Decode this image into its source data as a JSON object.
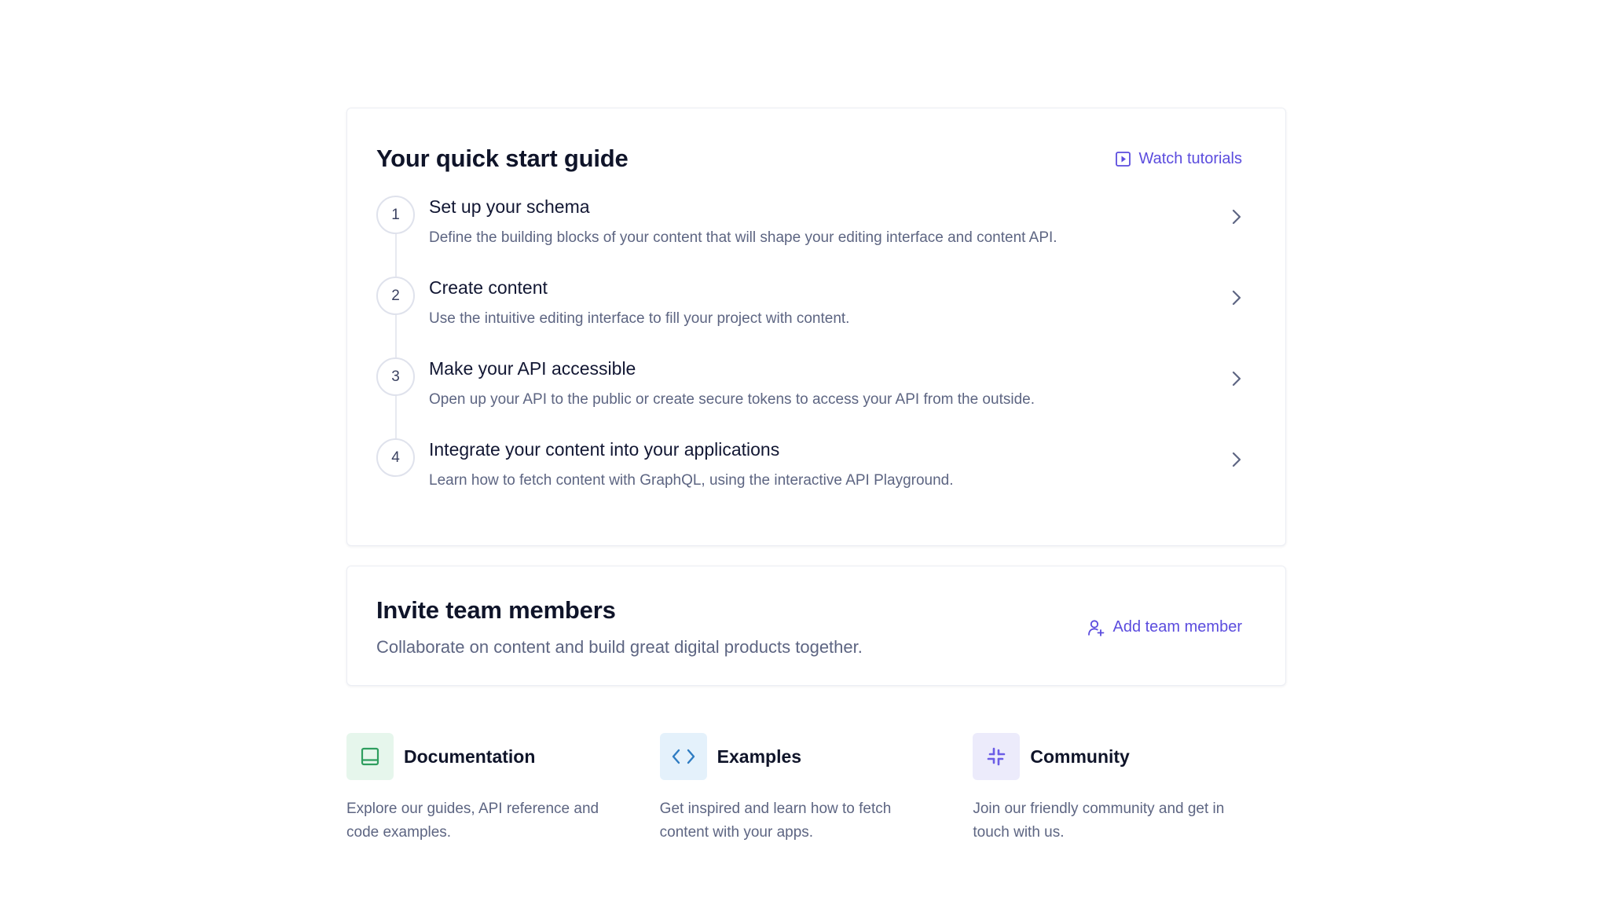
{
  "guide": {
    "title": "Your quick start guide",
    "watch_label": "Watch tutorials",
    "steps": [
      {
        "number": "1",
        "title": "Set up your schema",
        "description": "Define the building blocks of your content that will shape your editing interface and content API."
      },
      {
        "number": "2",
        "title": "Create content",
        "description": "Use the intuitive editing interface to fill your project with content."
      },
      {
        "number": "3",
        "title": "Make your API accessible",
        "description": "Open up your API to the public or create secure tokens to access your API from the outside."
      },
      {
        "number": "4",
        "title": "Integrate your content into your applications",
        "description": "Learn how to fetch content with GraphQL, using the interactive API Playground."
      }
    ]
  },
  "invite": {
    "title": "Invite team members",
    "subtitle": "Collaborate on content and build great digital products together.",
    "add_label": "Add team member"
  },
  "resources": [
    {
      "title": "Documentation",
      "description": "Explore our guides, API reference and code examples.",
      "icon": "book-icon",
      "icon_bg": "#e6f6ec",
      "icon_color": "#2f9e5f"
    },
    {
      "title": "Examples",
      "description": "Get inspired and learn how to fetch content with your apps.",
      "icon": "code-icon",
      "icon_bg": "#e4f1fb",
      "icon_color": "#2e7cc2"
    },
    {
      "title": "Community",
      "description": "Join our friendly community and get in touch with us.",
      "icon": "slack-icon",
      "icon_bg": "#ecebfb",
      "icon_color": "#6b5ce6"
    }
  ],
  "colors": {
    "accent": "#5b4cde",
    "text": "#0f1429",
    "muted": "#5d6582",
    "border": "#eceef4"
  }
}
